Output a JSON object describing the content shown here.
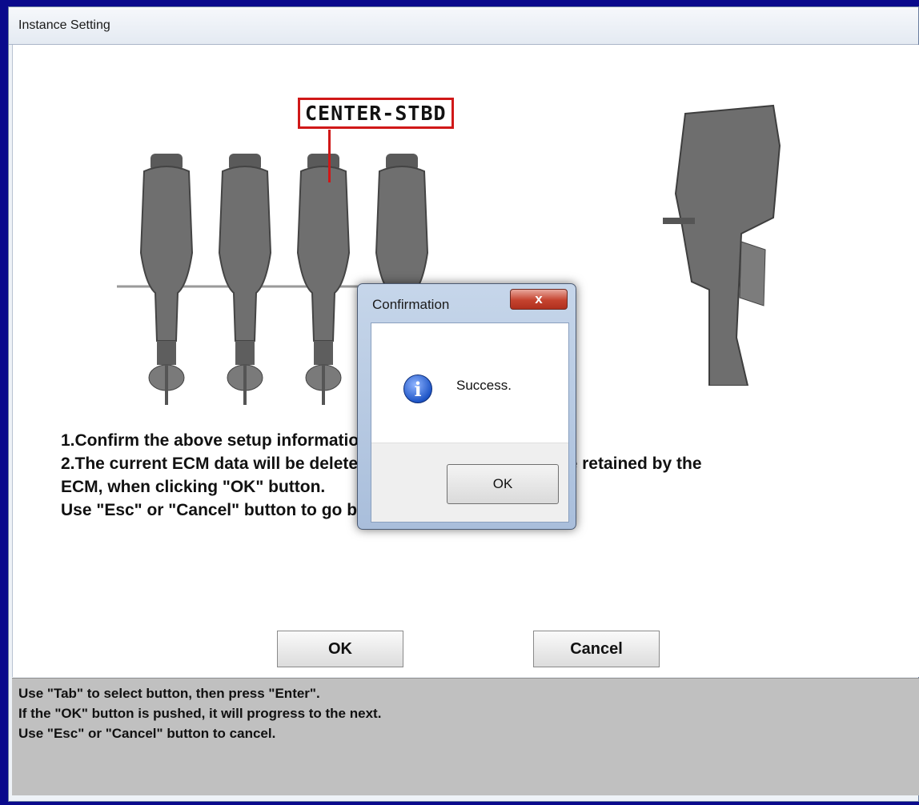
{
  "window": {
    "title": "Instance Setting"
  },
  "diagram": {
    "position_label": "CENTER-STBD"
  },
  "instructions": [
    "1.Confirm the above setup information.",
    "2.The current ECM data will be deleted and the setup data will be retained by the",
    "ECM, when clicking \"OK\" button.",
    "Use \"Esc\" or \"Cancel\" button to go back to previous screen."
  ],
  "buttons": {
    "ok": "OK",
    "cancel": "Cancel"
  },
  "status_help": [
    "Use \"Tab\" to select button, then press \"Enter\".",
    "If the \"OK\" button is pushed, it will progress to the next.",
    "Use \"Esc\" or \"Cancel\" button to cancel."
  ],
  "dialog": {
    "title": "Confirmation",
    "close_glyph": "x",
    "icon": "info-icon",
    "message": "Success.",
    "ok_label": "OK"
  }
}
